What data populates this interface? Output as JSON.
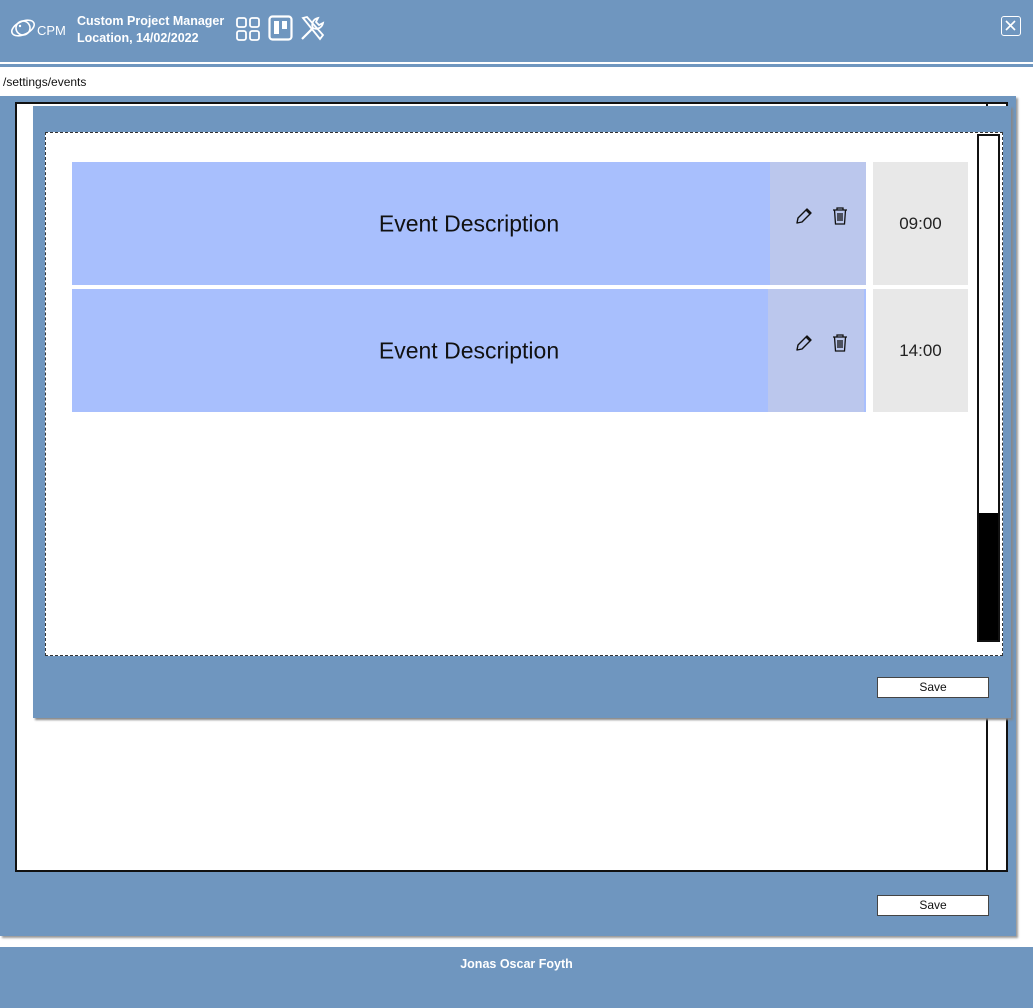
{
  "header": {
    "logo_text": "CPM",
    "app_name": "Custom Project Manager",
    "subtitle": "Location, 14/02/2022",
    "icons": [
      "grid-icon",
      "kanban-icon",
      "tools-icon",
      "close-icon"
    ]
  },
  "breadcrumb": "/settings/events",
  "events": [
    {
      "description": "Event Description",
      "time": "09:00"
    },
    {
      "description": "Event Description",
      "time": "14:00"
    }
  ],
  "inner_save_label": "Save",
  "outer_save_label": "Save",
  "footer": {
    "name": "Jonas Oscar Foyth"
  },
  "colors": {
    "primary": "#6f96bf",
    "event_bg": "#a8bffd",
    "actions_bg": "#bbc7ed",
    "time_bg": "#e8e8e8"
  }
}
